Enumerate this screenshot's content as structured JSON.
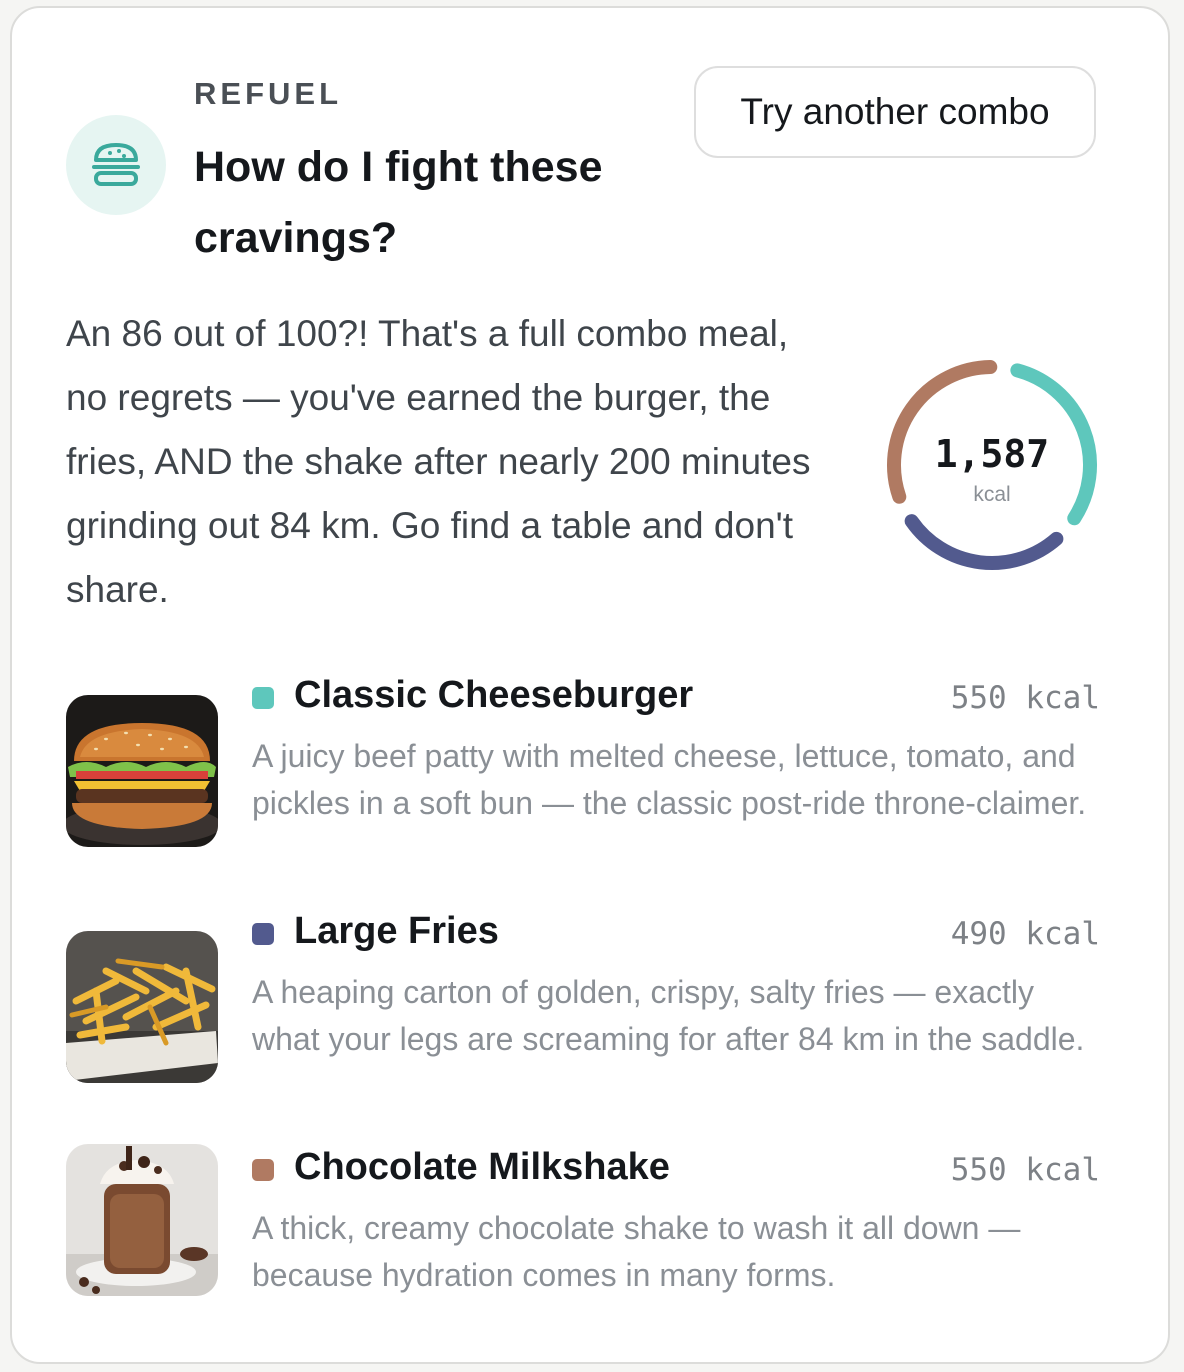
{
  "header": {
    "eyebrow": "REFUEL",
    "title": "How do I fight these cravings?",
    "icon": "burger-icon",
    "button_label": "Try another combo"
  },
  "blurb": "An 86 out of 100?! That's a full combo meal, no regrets — you've earned the burger, the fries, AND the shake after nearly 200 minutes grinding out 84 km. Go find a table and don't share.",
  "total": {
    "value": "1,587",
    "unit": "kcal"
  },
  "items": [
    {
      "name": "Classic Cheeseburger",
      "kcal": "550 kcal",
      "kcal_value": 550,
      "color": "#5ec7bc",
      "description": "A juicy beef patty with melted cheese, lettuce, tomato, and pickles in a soft bun — the classic post-ride throne-claimer.",
      "image": "cheeseburger-photo"
    },
    {
      "name": "Large Fries",
      "kcal": "490 kcal",
      "kcal_value": 490,
      "color": "#525a8e",
      "description": "A heaping carton of golden, crispy, salty fries — exactly what your legs are screaming for after 84 km in the saddle.",
      "image": "fries-photo"
    },
    {
      "name": "Chocolate Milkshake",
      "kcal": "550 kcal",
      "kcal_value": 550,
      "color": "#b07a62",
      "description": "A thick, creamy chocolate shake to wash it all down — because hydration comes in many forms.",
      "image": "milkshake-photo"
    }
  ],
  "colors": {
    "accent_bg": "#e6f5f2",
    "accent_icon": "#3aa99c"
  }
}
